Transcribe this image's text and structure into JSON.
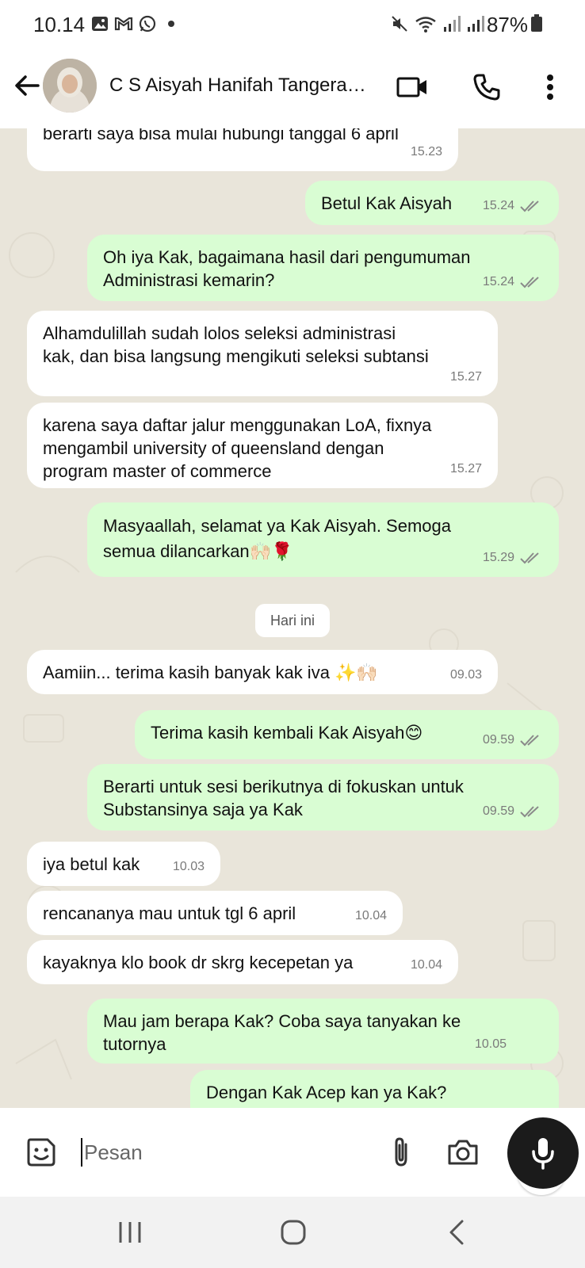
{
  "status_bar": {
    "time": "10.14",
    "battery": "87%",
    "left_icons": [
      "gallery-icon",
      "gmail-icon",
      "whatsapp-icon",
      "dot-icon"
    ],
    "right_icons": [
      "mute-icon",
      "wifi-icon",
      "signal-icon",
      "signal-icon",
      "battery-icon"
    ]
  },
  "header": {
    "contact_name": "C S Aisyah Hanifah Tangera…",
    "icons": [
      "back-arrow-icon",
      "video-call-icon",
      "phone-icon",
      "more-vert-icon"
    ]
  },
  "chat": {
    "partial_top": {
      "text": "berarti saya bisa mulai hubungi tanggal 6 april",
      "time": "15.23"
    },
    "messages": [
      {
        "text": "Betul Kak Aisyah",
        "time": "15.24",
        "dir": "out"
      },
      {
        "text": "Oh iya Kak, bagaimana hasil dari pengumuman\nAdministrasi kemarin?",
        "time": "15.24",
        "dir": "out"
      },
      {
        "text": "Alhamdulillah sudah lolos seleksi administrasi\nkak, dan bisa langsung mengikuti seleksi subtansi",
        "time": "15.27",
        "dir": "in"
      },
      {
        "text": "karena saya daftar jalur menggunakan LoA, fixnya\nmengambil university of queensland dengan\nprogram master of commerce",
        "time": "15.27",
        "dir": "in"
      },
      {
        "text": "Masyaallah, selamat ya Kak Aisyah. Semoga\nsemua dilancarkan🙌🏻🌹",
        "time": "15.29",
        "dir": "out"
      },
      {
        "text": "Aamiin... terima kasih banyak kak iva ✨🙌🏻",
        "time": "09.03",
        "dir": "in"
      },
      {
        "text": "Terima kasih kembali Kak Aisyah😊",
        "time": "09.59",
        "dir": "out"
      },
      {
        "text": "Berarti untuk sesi berikutnya di fokuskan untuk\nSubstansinya saja ya Kak",
        "time": "09.59",
        "dir": "out"
      },
      {
        "text": "iya betul kak",
        "time": "10.03",
        "dir": "in"
      },
      {
        "text": "rencananya mau untuk tgl  6 april",
        "time": "10.04",
        "dir": "in"
      },
      {
        "text": "kayaknya klo book dr skrg kecepetan ya",
        "time": "10.04",
        "dir": "in"
      },
      {
        "text": "Mau jam berapa Kak? Coba saya tanyakan ke\ntutornya",
        "time": "10.05",
        "dir": "out"
      }
    ],
    "partial_bottom": {
      "text": "Dengan Kak Acep kan ya Kak?"
    },
    "date_separator": "Hari ini"
  },
  "input": {
    "placeholder": "Pesan",
    "icons": [
      "emoji-sticker-icon",
      "attach-icon",
      "camera-icon",
      "mic-icon"
    ]
  },
  "nav": {
    "icons": [
      "recent-apps-icon",
      "home-icon",
      "back-icon"
    ]
  },
  "colors": {
    "incoming": "#ffffff",
    "outgoing": "#d9fdd3",
    "chat_bg": "#e9e5da",
    "mic_button": "#1b1b1b"
  }
}
